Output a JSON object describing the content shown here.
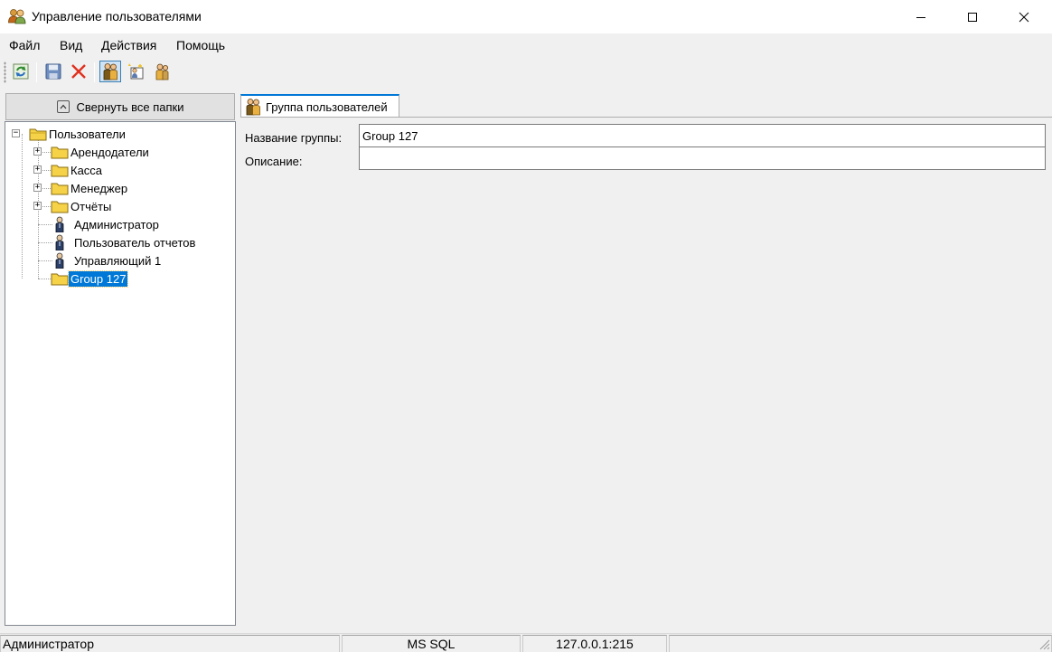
{
  "window": {
    "title": "Управление пользователями",
    "icon": "users-group-icon"
  },
  "menu": {
    "items": [
      "Файл",
      "Вид",
      "Действия",
      "Помощь"
    ]
  },
  "toolbar": {
    "buttons": [
      "refresh-icon",
      "save-icon",
      "delete-icon",
      "user-group-icon",
      "new-folder-icon",
      "new-user-icon"
    ]
  },
  "left_pane": {
    "collapse_label": "Свернуть все папки",
    "tree": {
      "root": "Пользователи",
      "folders": [
        "Арендодатели",
        "Касса",
        "Менеджер",
        "Отчёты"
      ],
      "users": [
        "Администратор",
        "Пользователь отчетов",
        "Управляющий 1"
      ],
      "selected_group": "Group 127"
    }
  },
  "tab": {
    "label": "Группа пользователей"
  },
  "form": {
    "name_label": "Название группы:",
    "name_value": "Group 127",
    "description_label": "Описание:",
    "description_value": ""
  },
  "status": {
    "user": "Администратор",
    "db": "MS SQL",
    "server": "127.0.0.1:215"
  },
  "colors": {
    "selection": "#0078d7",
    "folder": "#f5d247",
    "window_bg": "#f0f0f0"
  }
}
